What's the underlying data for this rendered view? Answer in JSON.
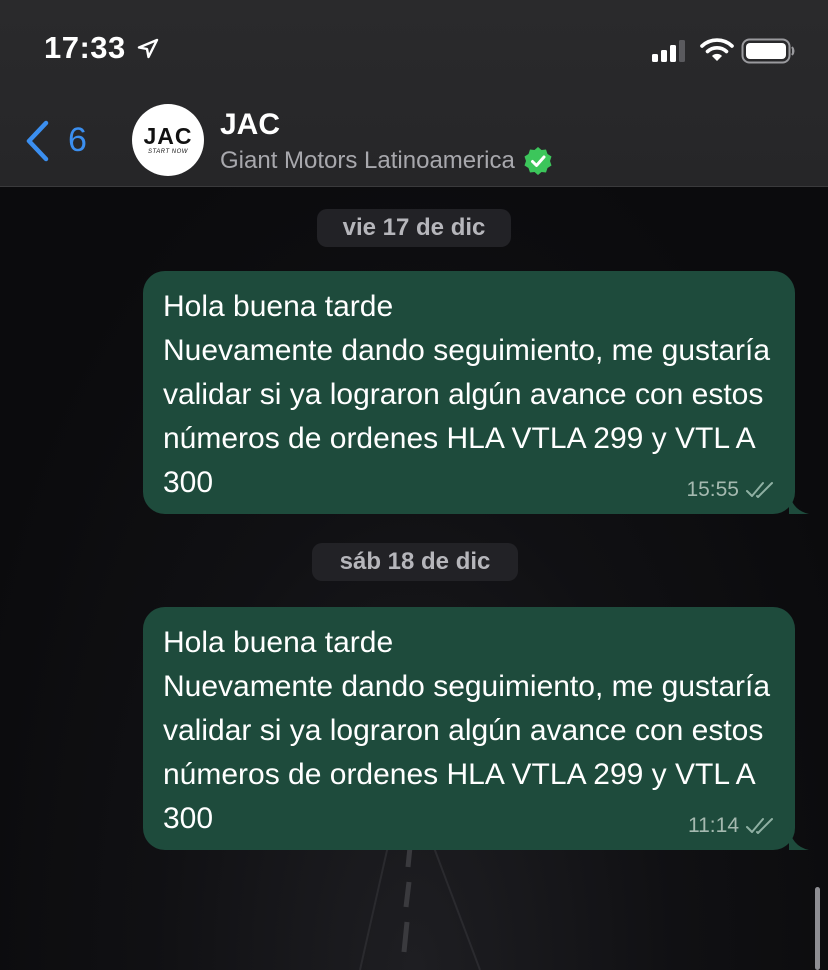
{
  "status_bar": {
    "time": "17:33",
    "icons": [
      "location-arrow-icon",
      "signal-bars-icon",
      "wifi-icon",
      "battery-icon"
    ]
  },
  "header": {
    "back_count": "6",
    "contact_name": "JAC",
    "contact_subtitle": "Giant Motors Latinoamerica",
    "avatar_logo": "JAC",
    "avatar_slogan": "START NOW",
    "verified": true
  },
  "chat": {
    "messages": [
      {
        "date_label": "vie 17 de dic",
        "text": "Hola buena tarde\nNuevamente dando seguimiento, me gustaría validar si ya lograron algún avance con estos números de ordenes HLA VTLA 299 y VTL A 300",
        "time": "15:55",
        "status": "read-ticks"
      },
      {
        "date_label": "sáb 18 de dic",
        "text": "Hola buena tarde\nNuevamente dando seguimiento, me gustaría validar si ya lograron algún avance con estos números de ordenes HLA VTLA 299 y VTL A 300",
        "time": "11:14",
        "status": "read-ticks"
      }
    ]
  },
  "colors": {
    "accent_blue": "#3b8ff0",
    "outgoing_bubble": "#1e4b3c",
    "verified_green": "#3cc65b",
    "header_bg": "#2a2a2c",
    "chat_bg": "#0b0b0d"
  }
}
